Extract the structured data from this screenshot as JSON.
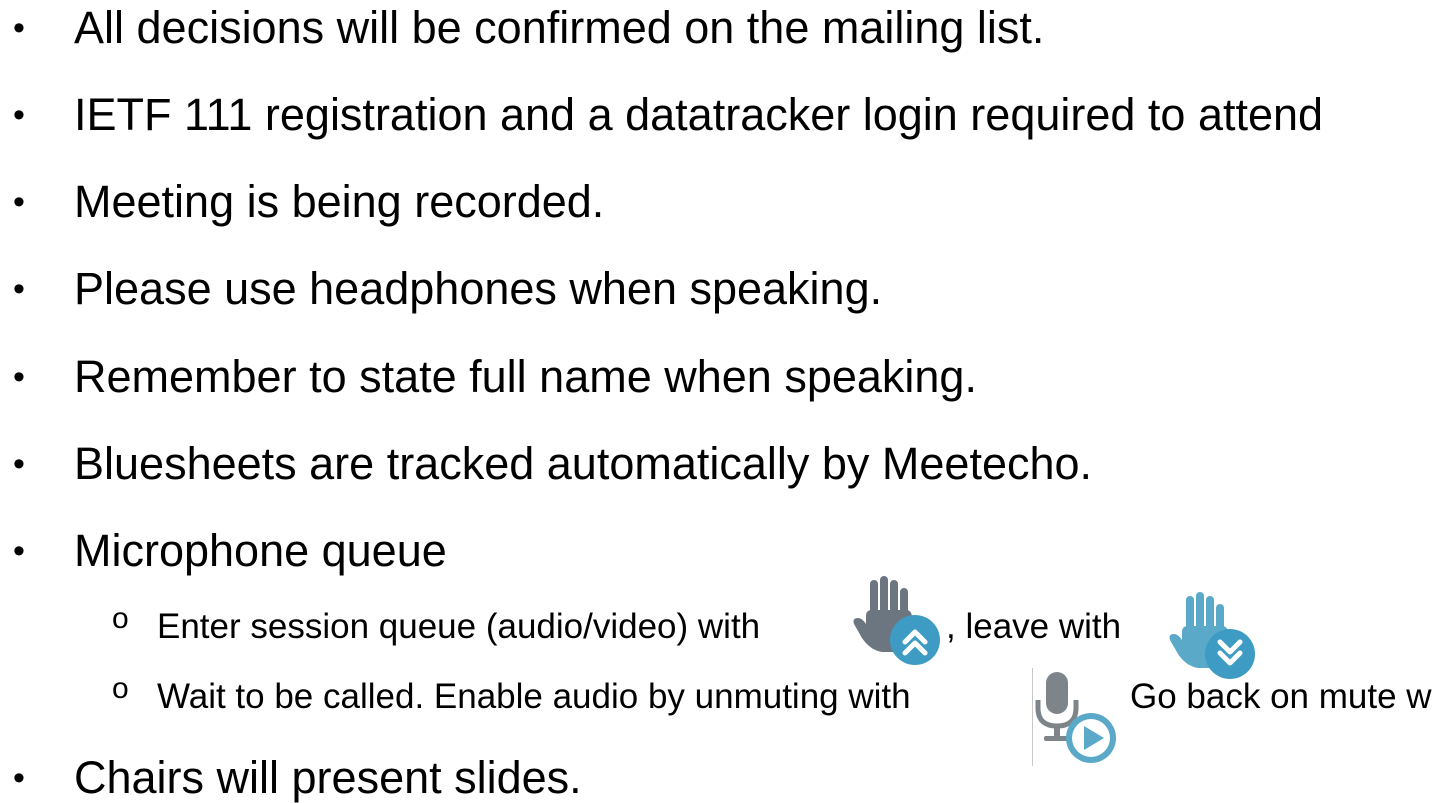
{
  "bullets": [
    {
      "text": "All decisions will be confirmed on the mailing list."
    },
    {
      "text": "IETF 111 registration and a datatracker login required to attend"
    },
    {
      "text": "Meeting is being recorded."
    },
    {
      "text": "Please use headphones when speaking."
    },
    {
      "text": "Remember to state full name when speaking."
    },
    {
      "text": "Bluesheets are tracked automatically by Meetecho."
    },
    {
      "text": "Microphone queue"
    },
    {
      "text": "Chairs will present slides."
    }
  ],
  "sub_bullets": {
    "marker": "o",
    "queue_enter_text": "Enter session queue (audio/video) with",
    "queue_leave_text": ", leave with",
    "unmute_text": "Wait to be called. Enable audio by unmuting with",
    "mute_text": "Go back on mute w"
  },
  "bullet_glyph": "•",
  "icons": {
    "raise_hand": "raise-hand-icon",
    "lower_hand": "lower-hand-icon",
    "microphone_unmute": "microphone-unmute-icon"
  },
  "colors": {
    "text": "#000000",
    "raise_hand_gray": "#6b7680",
    "hand_blue": "#5aa9c8",
    "badge_blue": "#3e9cc4",
    "mic_gray": "#7d848a"
  }
}
